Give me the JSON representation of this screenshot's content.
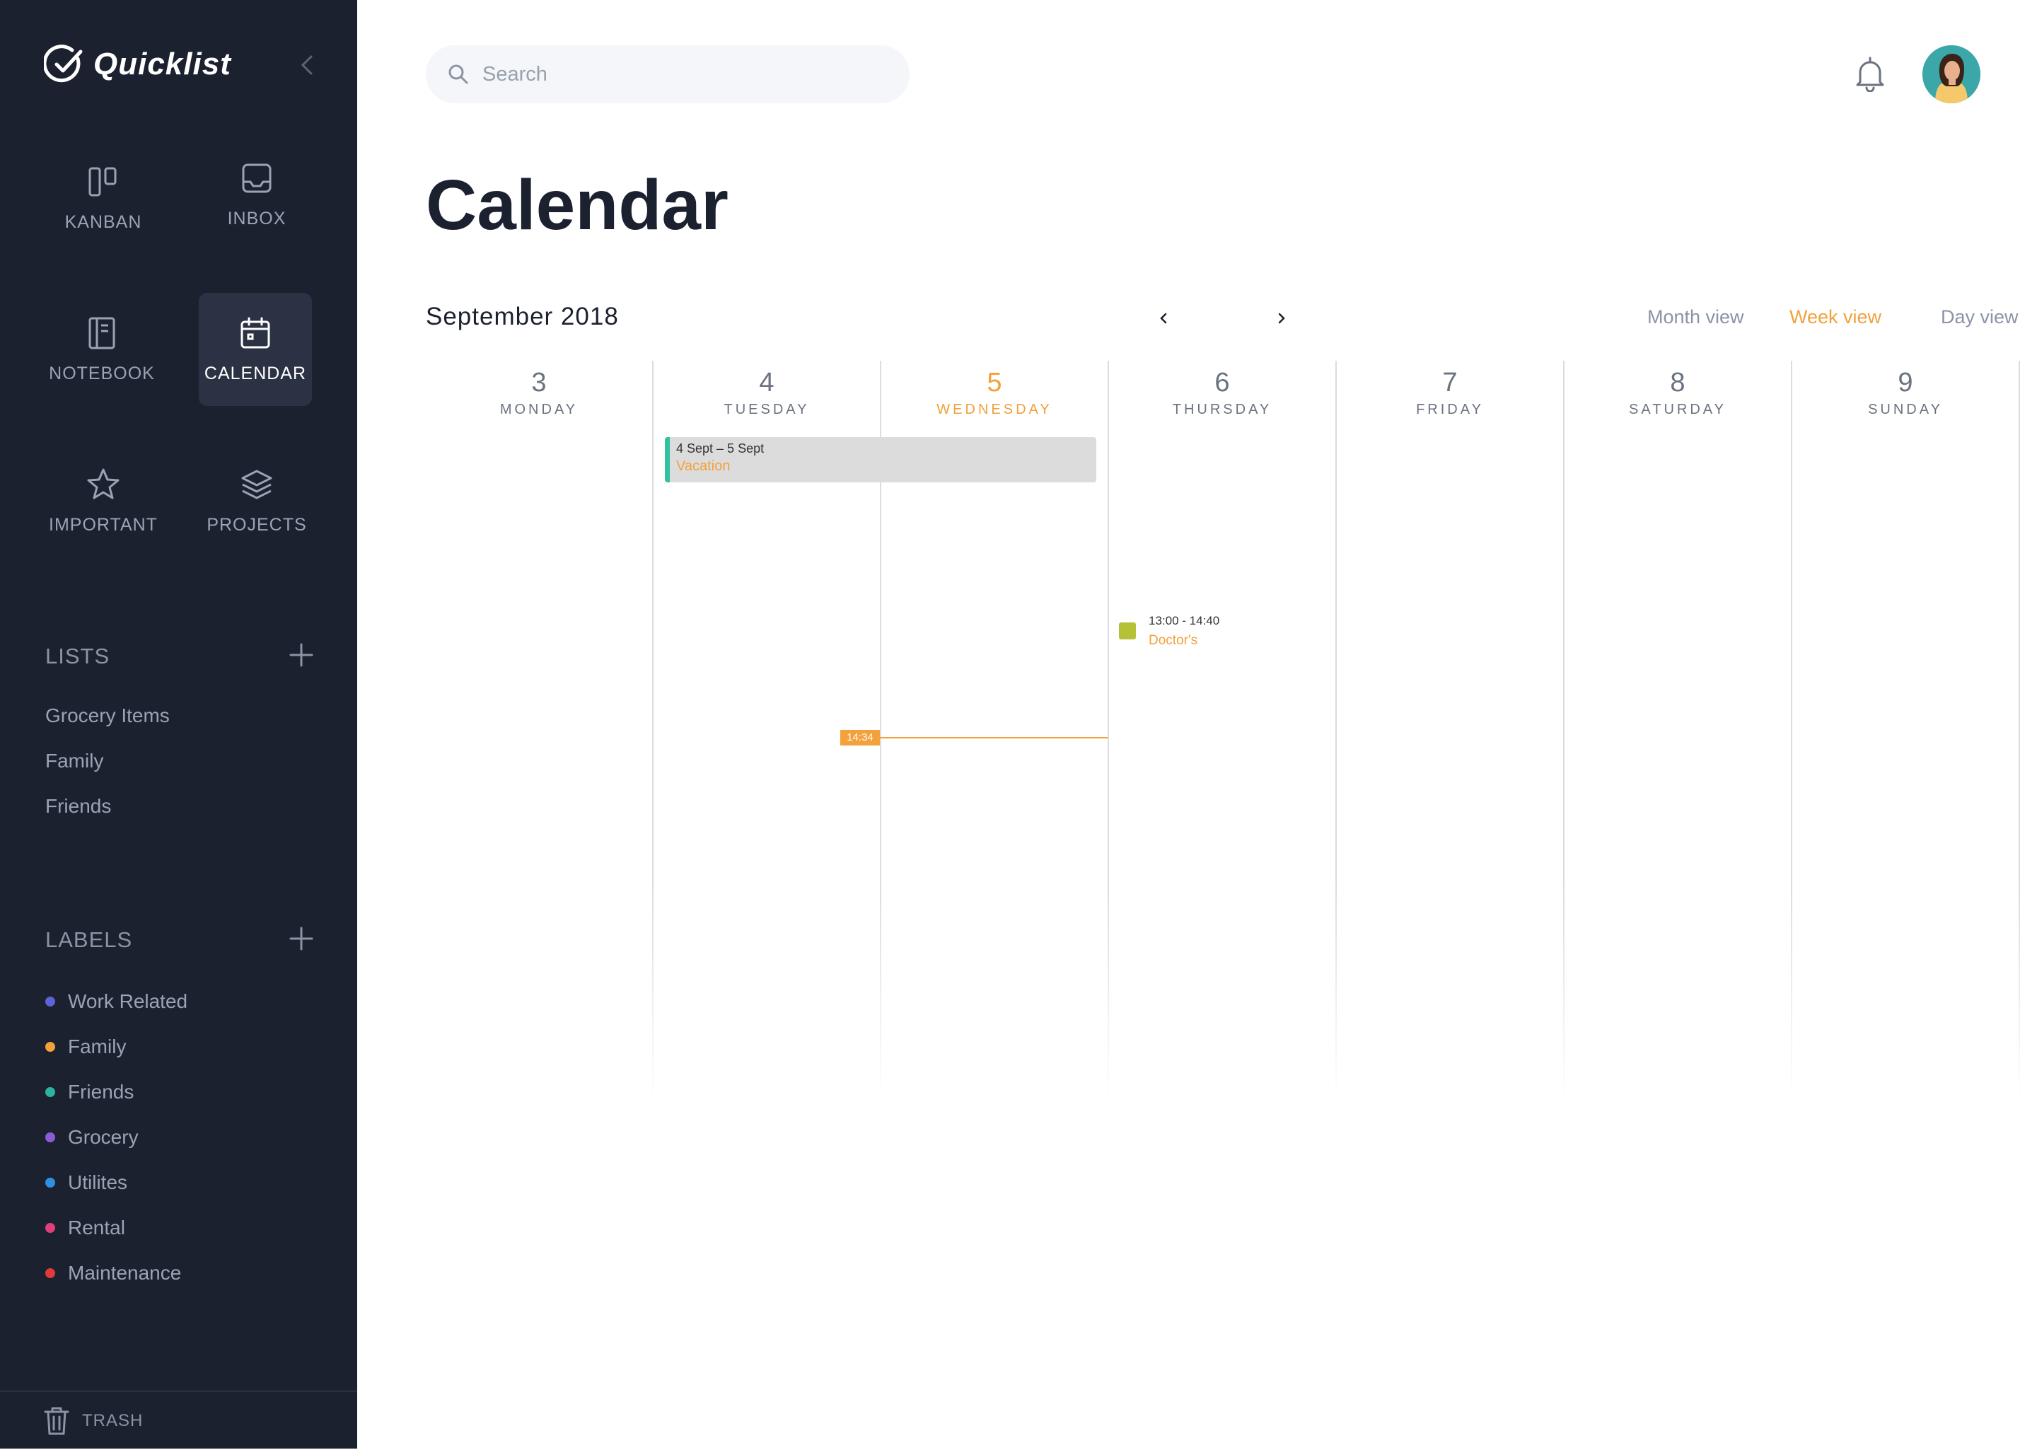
{
  "app": {
    "name": "Quicklist"
  },
  "nav": [
    {
      "label": "KANBAN",
      "icon": "kanban-icon"
    },
    {
      "label": "INBOX",
      "icon": "inbox-icon"
    },
    {
      "label": "NOTEBOOK",
      "icon": "notebook-icon"
    },
    {
      "label": "CALENDAR",
      "icon": "calendar-icon",
      "active": true
    },
    {
      "label": "IMPORTANT",
      "icon": "star-icon"
    },
    {
      "label": "PROJECTS",
      "icon": "layers-icon"
    }
  ],
  "lists": {
    "title": "LISTS",
    "items": [
      "Grocery Items",
      "Family",
      "Friends"
    ]
  },
  "labels": {
    "title": "LABELS",
    "items": [
      {
        "name": "Work Related",
        "color": "#5b63d6"
      },
      {
        "name": "Family",
        "color": "#f2a13c"
      },
      {
        "name": "Friends",
        "color": "#2bb3a0"
      },
      {
        "name": "Grocery",
        "color": "#8b5cd6"
      },
      {
        "name": "Utilites",
        "color": "#2f8fe0"
      },
      {
        "name": "Rental",
        "color": "#e0407a"
      },
      {
        "name": "Maintenance",
        "color": "#e03a3a"
      }
    ]
  },
  "footer": {
    "trash_label": "TRASH"
  },
  "search": {
    "placeholder": "Search"
  },
  "page": {
    "title": "Calendar"
  },
  "calendar": {
    "month_label": "September 2018",
    "views": [
      {
        "label": "Month view",
        "active": false
      },
      {
        "label": "Week view",
        "active": true
      },
      {
        "label": "Day view",
        "active": false
      }
    ],
    "days": [
      {
        "num": "3",
        "name": "MONDAY"
      },
      {
        "num": "4",
        "name": "TUESDAY"
      },
      {
        "num": "5",
        "name": "WEDNESDAY",
        "today": true
      },
      {
        "num": "6",
        "name": "THURSDAY"
      },
      {
        "num": "7",
        "name": "FRIDAY"
      },
      {
        "num": "8",
        "name": "SATURDAY"
      },
      {
        "num": "9",
        "name": "SUNDAY"
      }
    ],
    "events": [
      {
        "date_range": "4 Sept – 5 Sept",
        "title": "Vacation",
        "color": "#2fc1a0"
      },
      {
        "time": "13:00 - 14:40",
        "title": "Doctor's",
        "color": "#b5c237"
      }
    ],
    "now_time": "14:34",
    "accent": "#f2a13c"
  }
}
